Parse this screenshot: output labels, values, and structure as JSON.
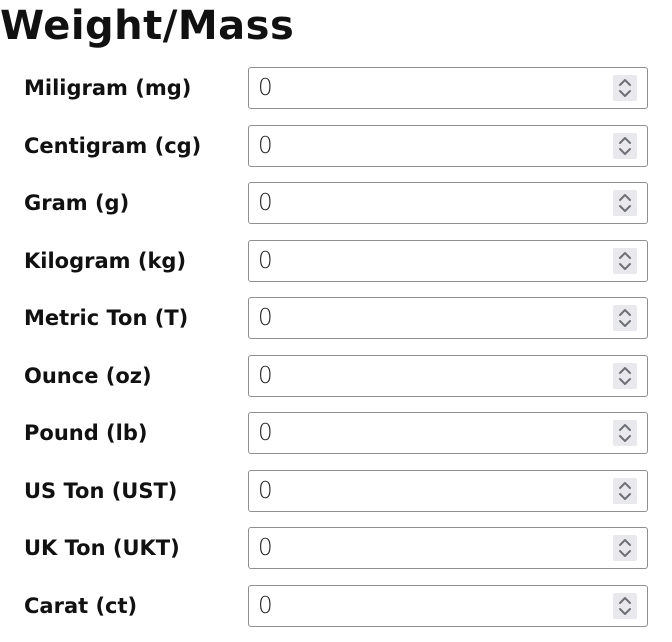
{
  "page": {
    "title": "Weight/Mass"
  },
  "units": [
    {
      "label": "Miligram (mg)",
      "value": "0"
    },
    {
      "label": "Centigram (cg)",
      "value": "0"
    },
    {
      "label": "Gram (g)",
      "value": "0"
    },
    {
      "label": "Kilogram (kg)",
      "value": "0"
    },
    {
      "label": "Metric Ton (T)",
      "value": "0"
    },
    {
      "label": "Ounce (oz)",
      "value": "0"
    },
    {
      "label": "Pound (lb)",
      "value": "0"
    },
    {
      "label": "US Ton (UST)",
      "value": "0"
    },
    {
      "label": "UK Ton (UKT)",
      "value": "0"
    },
    {
      "label": "Carat (ct)",
      "value": "0"
    }
  ],
  "icons": {
    "spinner": "chevron-up-down-icon"
  },
  "colors": {
    "text": "#111111",
    "input_border": "#8f8f8f",
    "spinner_background": "#e9e9ed",
    "spinner_arrow": "#6f6f78"
  }
}
